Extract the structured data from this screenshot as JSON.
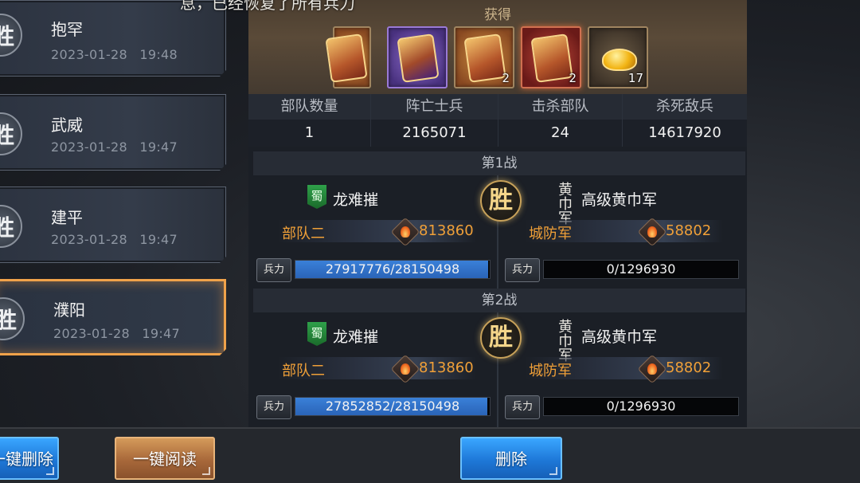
{
  "top_message": "息，已经恢复了所有兵力",
  "reports": [
    {
      "badge": "胜",
      "name": "抱罕",
      "time": "2023-01-28 19:48",
      "selected": false
    },
    {
      "badge": "胜",
      "name": "武威",
      "time": "2023-01-28 19:47",
      "selected": false
    },
    {
      "badge": "胜",
      "name": "建平",
      "time": "2023-01-28 19:47",
      "selected": false
    },
    {
      "badge": "胜",
      "name": "濮阳",
      "time": "2023-01-28 19:47",
      "selected": true
    }
  ],
  "rewards": {
    "title": "获得",
    "items": [
      {
        "icon": "troop-token-icon",
        "count": ""
      },
      {
        "icon": "purple-token-icon",
        "count": ""
      },
      {
        "icon": "troop-token-icon",
        "count": "2"
      },
      {
        "icon": "red-token-icon",
        "count": "2"
      },
      {
        "icon": "gold-ingot-icon",
        "count": "17"
      }
    ]
  },
  "stats": {
    "headers": [
      "部队数量",
      "阵亡士兵",
      "击杀部队",
      "杀死敌兵"
    ],
    "values": [
      "1",
      "2165071",
      "24",
      "14617920"
    ]
  },
  "battles": [
    {
      "title": "第1战",
      "result": "胜",
      "left": {
        "faction": "蜀",
        "player": "龙难摧",
        "unit": "部队二",
        "power": "813860",
        "troop_label": "兵力",
        "troops_text": "27917776/28150498",
        "troops_fraction": 0.9917
      },
      "right": {
        "faction": "黄巾军",
        "player": "高级黄巾军",
        "unit": "城防军",
        "power": "58802",
        "troop_label": "兵力",
        "troops_text": "0/1296930",
        "troops_fraction": 0
      }
    },
    {
      "title": "第2战",
      "result": "胜",
      "left": {
        "faction": "蜀",
        "player": "龙难摧",
        "unit": "部队二",
        "power": "813860",
        "troop_label": "兵力",
        "troops_text": "27852852/28150498",
        "troops_fraction": 0.9894
      },
      "right": {
        "faction": "黄巾军",
        "player": "高级黄巾军",
        "unit": "城防军",
        "power": "58802",
        "troop_label": "兵力",
        "troops_text": "0/1296930",
        "troops_fraction": 0
      }
    }
  ],
  "buttons": {
    "delete_all": "一键删除",
    "read_all": "一键阅读",
    "delete": "删除"
  },
  "colors": {
    "accent_orange": "#f0a038",
    "selected_glow": "#f0a24a",
    "troop_bar": "#3a80d8",
    "button_blue": "#1e78d8",
    "button_brown": "#a8683a"
  }
}
